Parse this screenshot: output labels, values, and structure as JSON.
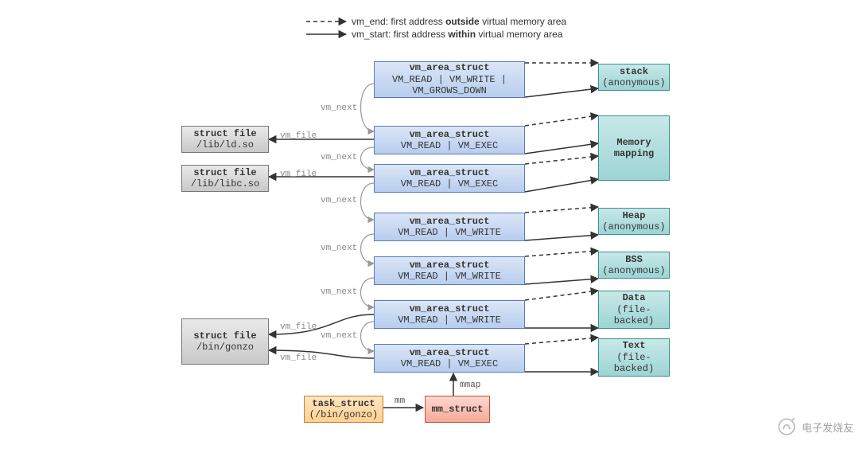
{
  "legend": {
    "vm_end_prefix": "vm_end: first address ",
    "vm_end_bold": "outside",
    "vm_end_suffix": " virtual memory area",
    "vm_start_prefix": "vm_start: first address ",
    "vm_start_bold": "within",
    "vm_start_suffix": " virtual memory area"
  },
  "labels": {
    "vm_next": "vm_next",
    "vm_file": "vm_file",
    "mm": "mm",
    "mmap": "mmap"
  },
  "vma": [
    {
      "title": "vm_area_struct",
      "flags": "VM_READ | VM_WRITE | VM_GROWS_DOWN"
    },
    {
      "title": "vm_area_struct",
      "flags": "VM_READ | VM_EXEC"
    },
    {
      "title": "vm_area_struct",
      "flags": "VM_READ | VM_EXEC"
    },
    {
      "title": "vm_area_struct",
      "flags": "VM_READ | VM_WRITE"
    },
    {
      "title": "vm_area_struct",
      "flags": "VM_READ | VM_WRITE"
    },
    {
      "title": "vm_area_struct",
      "flags": "VM_READ | VM_WRITE"
    },
    {
      "title": "vm_area_struct",
      "flags": "VM_READ | VM_EXEC"
    }
  ],
  "regions": [
    {
      "name": "stack",
      "sub": "(anonymous)"
    },
    {
      "name": "Memory mapping",
      "sub": ""
    },
    {
      "name": "Heap",
      "sub": "(anonymous)"
    },
    {
      "name": "BSS",
      "sub": "(anonymous)"
    },
    {
      "name": "Data",
      "sub": "(file-backed)"
    },
    {
      "name": "Text",
      "sub": "(file-backed)"
    }
  ],
  "files": [
    {
      "title": "struct file",
      "path": "/lib/ld.so"
    },
    {
      "title": "struct file",
      "path": "/lib/libc.so"
    },
    {
      "title": "struct file",
      "path": "/bin/gonzo"
    }
  ],
  "task": {
    "title": "task_struct",
    "sub": "(/bin/gonzo)"
  },
  "mm": {
    "title": "mm_struct"
  },
  "watermark": "电子发烧友"
}
